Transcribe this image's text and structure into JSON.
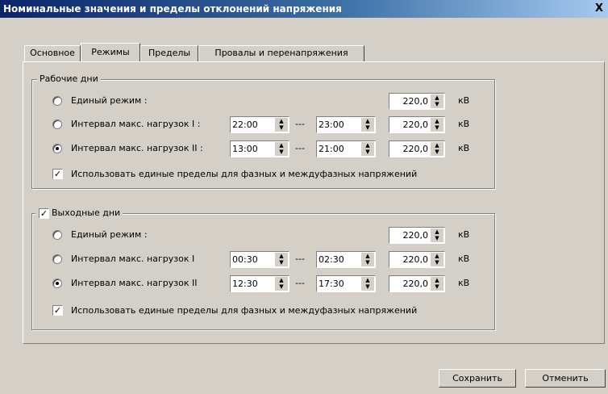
{
  "window": {
    "title": "Номинальные значения и пределы отклонений напряжения",
    "close_glyph": "X"
  },
  "tabs": [
    {
      "label": "Основное",
      "active": false
    },
    {
      "label": "Режимы",
      "active": true
    },
    {
      "label": "Пределы",
      "active": false
    },
    {
      "label": "Провалы и перенапряжения",
      "active": false
    }
  ],
  "workdays": {
    "label": "Рабочие дни",
    "single": {
      "label": "Единый режим :",
      "selected": false,
      "value": "220,0",
      "unit": "кВ"
    },
    "interval1": {
      "label": "Интервал макс. нагрузок I :",
      "selected": false,
      "from": "22:00",
      "to": "23:00",
      "value": "220,0",
      "unit": "кВ"
    },
    "interval2": {
      "label": "Интервал макс. нагрузок II :",
      "selected": true,
      "from": "13:00",
      "to": "21:00",
      "value": "220,0",
      "unit": "кВ"
    },
    "use_same_limits": {
      "label": "Использовать единые пределы для фазных и междуфазных напряжений",
      "checked": true
    }
  },
  "weekends": {
    "label": "Выходные дни",
    "checked": true,
    "single": {
      "label": "Единый режим :",
      "selected": false,
      "value": "220,0",
      "unit": "кВ"
    },
    "interval1": {
      "label": "Интервал макс. нагрузок I",
      "selected": false,
      "from": "00:30",
      "to": "02:30",
      "value": "220,0",
      "unit": "кВ"
    },
    "interval2": {
      "label": "Интервал макс. нагрузок II",
      "selected": true,
      "from": "12:30",
      "to": "17:30",
      "value": "220,0",
      "unit": "кВ"
    },
    "use_same_limits": {
      "label": "Использовать единые пределы для фазных и междуфазных напряжений",
      "checked": true
    }
  },
  "separator": "---",
  "spin_up": "▲",
  "spin_down": "▼",
  "check_mark": "✓",
  "buttons": {
    "save": "Сохранить",
    "cancel": "Отменить"
  }
}
